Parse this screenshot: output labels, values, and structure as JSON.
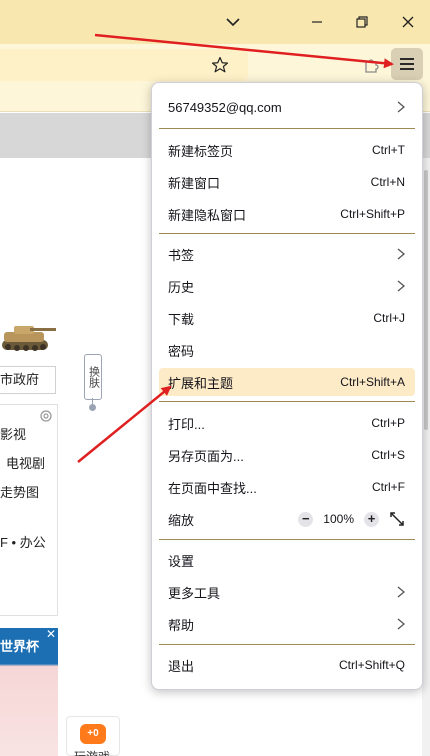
{
  "menu": {
    "account": "56749352@qq.com",
    "new_tab": {
      "label": "新建标签页",
      "shortcut": "Ctrl+T"
    },
    "new_window": {
      "label": "新建窗口",
      "shortcut": "Ctrl+N"
    },
    "new_private": {
      "label": "新建隐私窗口",
      "shortcut": "Ctrl+Shift+P"
    },
    "bookmarks": {
      "label": "书签"
    },
    "history": {
      "label": "历史"
    },
    "downloads": {
      "label": "下载",
      "shortcut": "Ctrl+J"
    },
    "passwords": {
      "label": "密码"
    },
    "addons": {
      "label": "扩展和主题",
      "shortcut": "Ctrl+Shift+A"
    },
    "print": {
      "label": "打印...",
      "shortcut": "Ctrl+P"
    },
    "save_as": {
      "label": "另存页面为...",
      "shortcut": "Ctrl+S"
    },
    "find": {
      "label": "在页面中查找...",
      "shortcut": "Ctrl+F"
    },
    "zoom": {
      "label": "缩放",
      "minus": "−",
      "value": "100%",
      "plus": "+"
    },
    "settings": {
      "label": "设置"
    },
    "more_tools": {
      "label": "更多工具"
    },
    "help": {
      "label": "帮助"
    },
    "quit": {
      "label": "退出",
      "shortcut": "Ctrl+Shift+Q"
    }
  },
  "page": {
    "city": "市政府",
    "skin": "换肤",
    "items": [
      "影视",
      "电视剧",
      "走势图",
      "F • 办公"
    ],
    "banner": "世界杯",
    "game_icon": "+0",
    "game_label": "玩游戏"
  },
  "colors": {
    "titlebar": "#f8e8b0",
    "highlight": "#fdebc8",
    "arrow": "#e02020"
  }
}
